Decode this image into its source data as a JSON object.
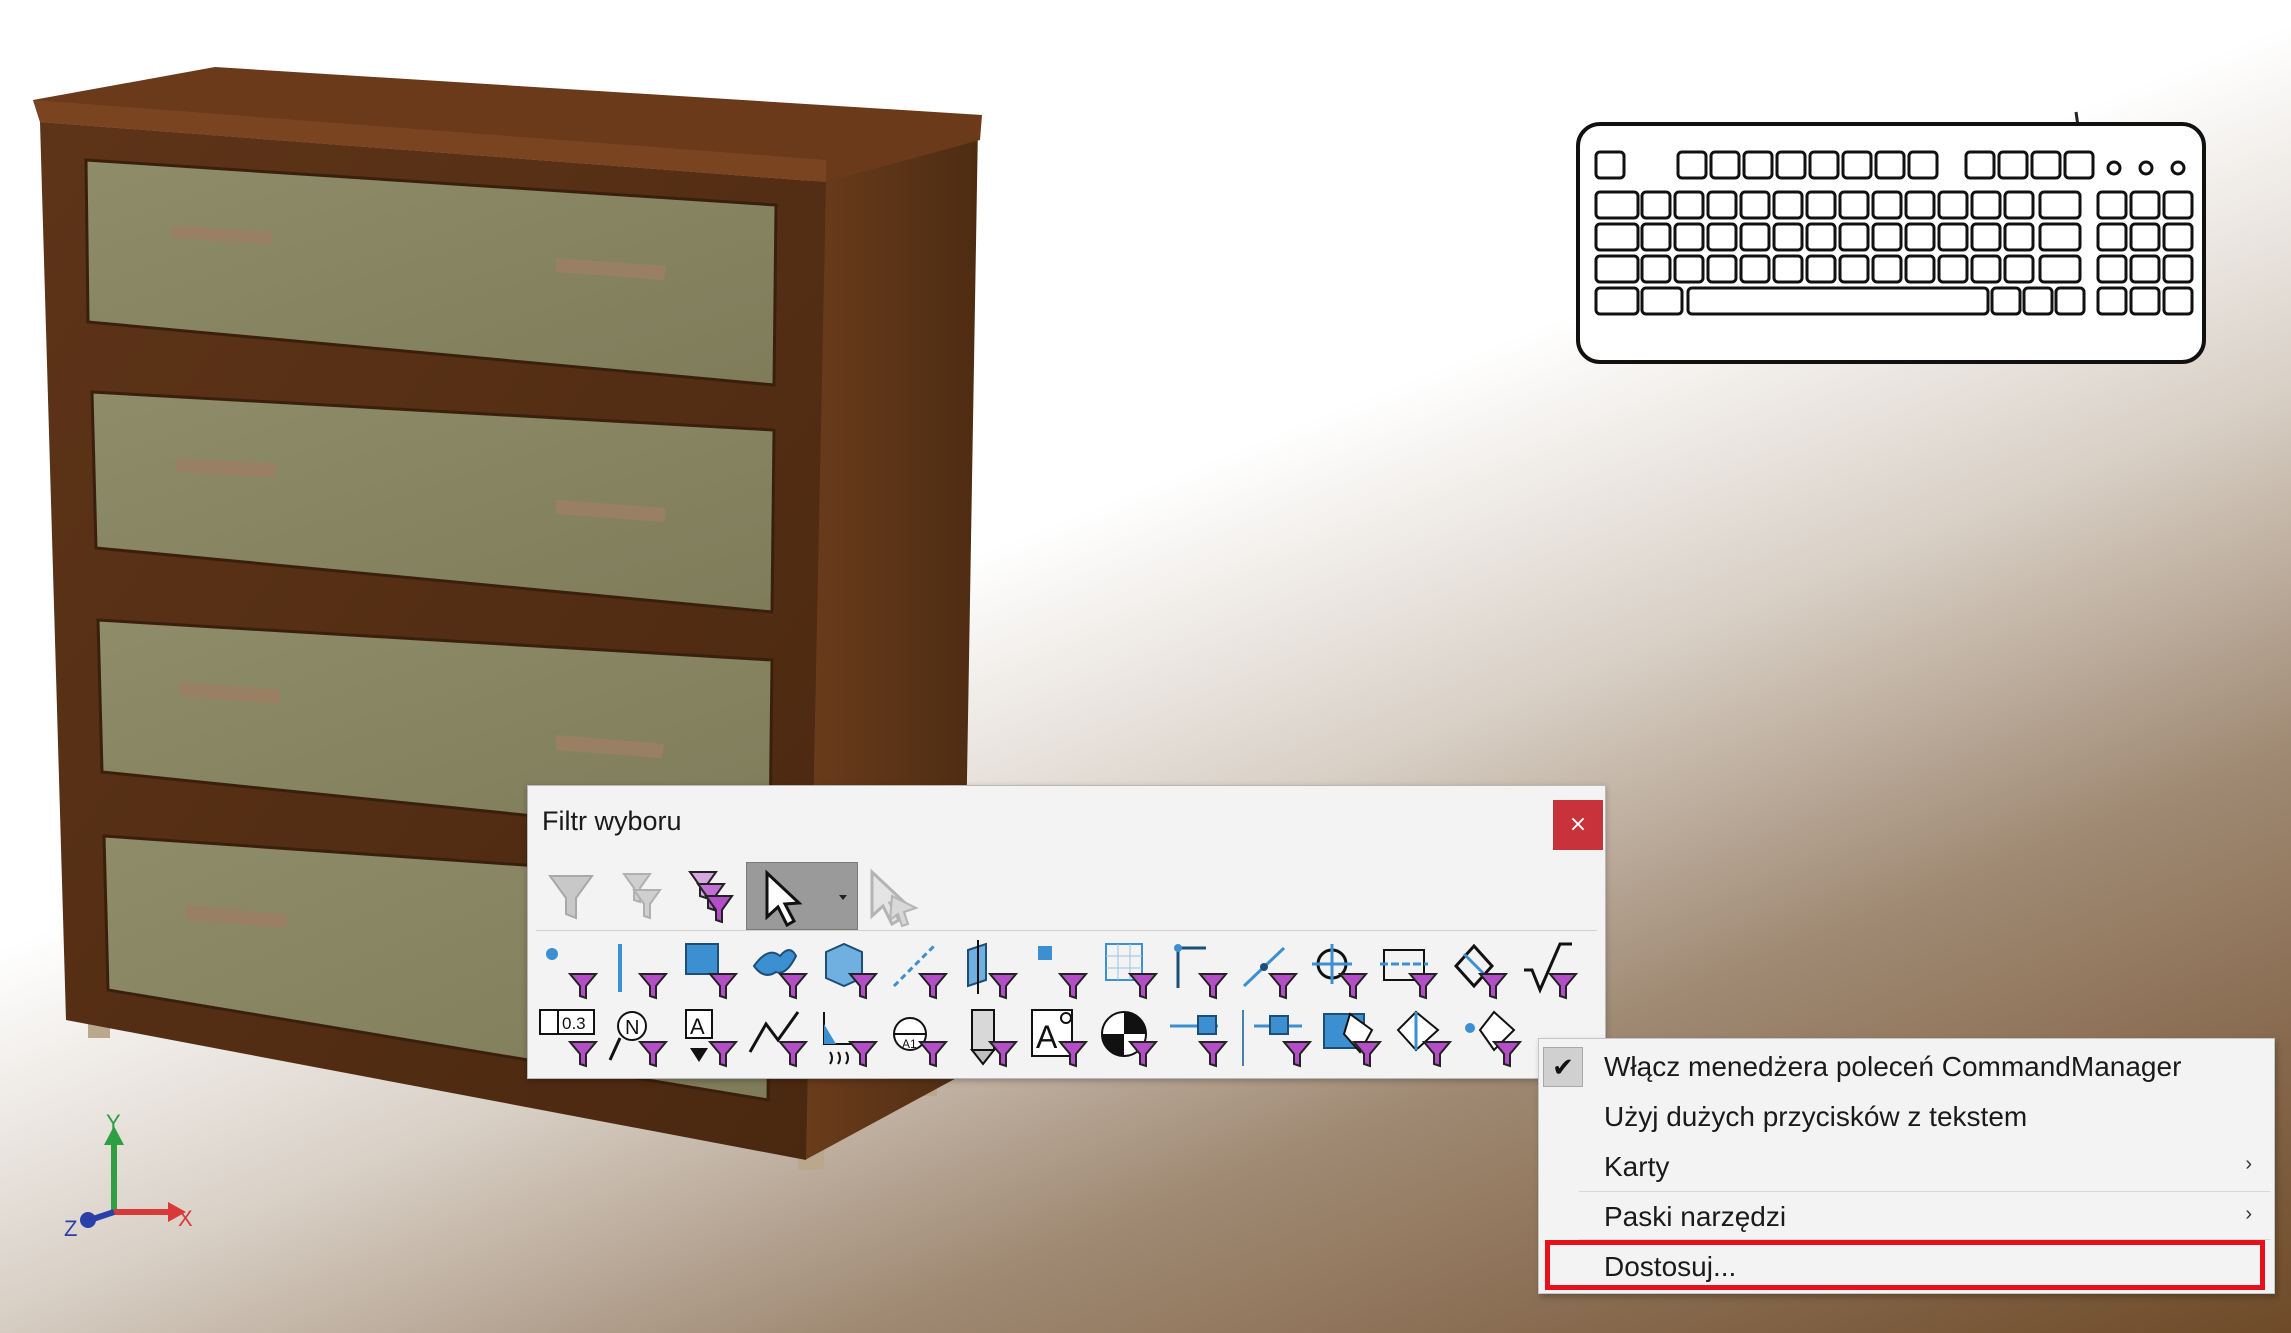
{
  "selection_filter": {
    "title": "Filtr wyboru",
    "close_glyph": "×",
    "top_tools": [
      "filter-toggle-icon",
      "clear-all-filters-icon",
      "select-all-filters-icon",
      "selection-cursor-icon",
      "dropdown-arrow-icon",
      "pointer-disabled-icon"
    ],
    "row1": [
      "filter-vertices-icon",
      "filter-edges-icon",
      "filter-faces-icon",
      "filter-surface-bodies-icon",
      "filter-solid-bodies-icon",
      "filter-axes-icon",
      "filter-planes-icon",
      "filter-sketch-points-icon",
      "filter-sketch-segments-icon",
      "filter-midpoints-icon",
      "filter-dimensions-icon",
      "filter-center-marks-icon",
      "filter-centerlines-icon",
      "filter-dimensions-hole-callouts-icon",
      "filter-surface-finish-icon"
    ],
    "row2_label": "0.3",
    "row2": [
      "filter-geometric-tolerances-icon",
      "filter-notes-icon",
      "filter-datum-features-icon",
      "filter-weld-symbols-icon",
      "filter-weld-beads-icon",
      "filter-datum-targets-icon",
      "filter-cosmetic-threads-icon",
      "filter-blocks-icon",
      "filter-center-of-mass-icon",
      "filter-connection-points-icon",
      "filter-routing-points-icon",
      "filter-mesh-facets-icon",
      "filter-mesh-facet-edges-icon",
      "filter-mesh-facet-vertices-icon"
    ],
    "accent_color": "#b44ec8"
  },
  "context_menu": {
    "items": [
      {
        "label": "Włącz menedżera poleceń CommandManager",
        "checked": true
      },
      {
        "label": "Użyj dużych przycisków z tekstem",
        "checked": false
      },
      {
        "label": "Karty",
        "submenu": true
      },
      {
        "label": "Paski narzędzi",
        "submenu": true
      },
      {
        "label": "Dostosuj...",
        "highlighted": true
      }
    ],
    "submenu_arrow": "›",
    "check_glyph": "✔",
    "highlight_color": "#e8101a"
  },
  "triad": {
    "x_label": "X",
    "y_label": "Y",
    "z_label": "Z"
  },
  "scene": {
    "model": "chest-of-drawers",
    "wood_color": "#5a3216",
    "panel_color": "#8c8966",
    "background_gradient": [
      "#ffffff",
      "#6e4a28"
    ]
  }
}
